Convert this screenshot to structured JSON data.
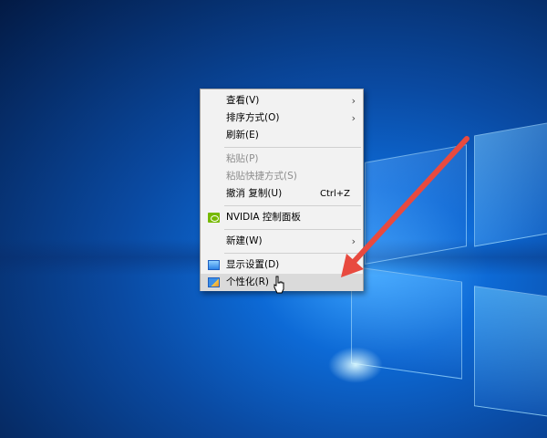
{
  "menu": {
    "items": [
      {
        "label": "查看(V)",
        "has_submenu": true,
        "disabled": false
      },
      {
        "label": "排序方式(O)",
        "has_submenu": true,
        "disabled": false
      },
      {
        "label": "刷新(E)",
        "has_submenu": false,
        "disabled": false
      },
      {
        "label": "粘贴(P)",
        "has_submenu": false,
        "disabled": true
      },
      {
        "label": "粘贴快捷方式(S)",
        "has_submenu": false,
        "disabled": true
      },
      {
        "label": "撤消 复制(U)",
        "shortcut": "Ctrl+Z",
        "disabled": false
      },
      {
        "label": "NVIDIA 控制面板",
        "icon": "nvidia-icon",
        "disabled": false
      },
      {
        "label": "新建(W)",
        "has_submenu": true,
        "disabled": false
      },
      {
        "label": "显示设置(D)",
        "icon": "display-settings-icon",
        "disabled": false
      },
      {
        "label": "个性化(R)",
        "icon": "personalize-icon",
        "disabled": false,
        "highlighted": true
      }
    ],
    "submenu_glyph": "›"
  },
  "annotation": {
    "color": "#e84a3f",
    "icon": "red-arrow"
  }
}
